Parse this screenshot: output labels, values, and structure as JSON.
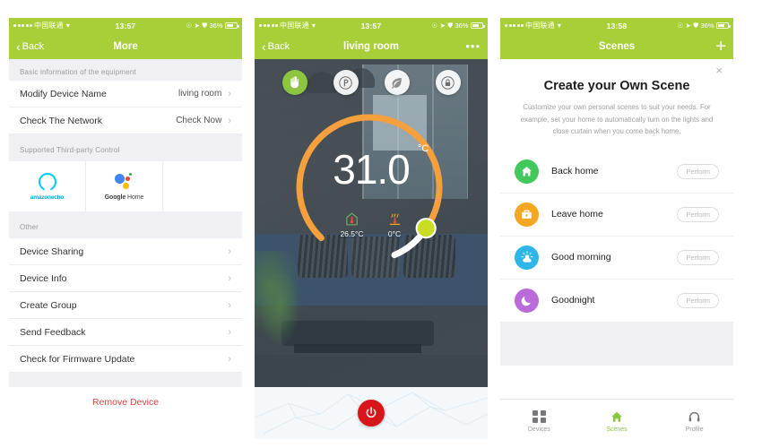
{
  "status_bar": {
    "carrier": "中国联通",
    "wifi_icon": "wifi-icon",
    "time_panel1": "13:57",
    "time_panel2": "13:57",
    "time_panel3": "13:58",
    "battery_pct": "36%",
    "alarm_icon": "alarm-icon",
    "location_icon": "location-arrow-icon",
    "rotation_icon": "rotation-lock-icon"
  },
  "panel1": {
    "nav": {
      "back_label": "Back",
      "title": "More"
    },
    "section_basic": "Basic information of the equipment",
    "rows_basic": [
      {
        "label": "Modify Device Name",
        "value": "living room"
      },
      {
        "label": "Check The Network",
        "value": "Check Now"
      }
    ],
    "section_third_party": "Supported Third-party Control",
    "third_party": [
      {
        "name": "amazon echo",
        "brand": "amazon",
        "product": "echo"
      },
      {
        "name": "Google Home",
        "brand": "Google",
        "product": "Home"
      }
    ],
    "section_other": "Other",
    "rows_other": [
      {
        "label": "Device Sharing"
      },
      {
        "label": "Device Info"
      },
      {
        "label": "Create Group"
      },
      {
        "label": "Send Feedback"
      },
      {
        "label": "Check for Firmware Update"
      }
    ],
    "remove_label": "Remove Device"
  },
  "panel2": {
    "nav": {
      "back_label": "Back",
      "title": "living room",
      "more_label": "•••"
    },
    "modes": [
      {
        "name": "manual-mode",
        "icon": "hand-icon",
        "active": true
      },
      {
        "name": "program-mode",
        "icon": "program-p-icon",
        "active": false
      },
      {
        "name": "eco-mode",
        "icon": "leaf-icon",
        "active": false
      },
      {
        "name": "lock-mode",
        "icon": "lock-icon",
        "active": false
      }
    ],
    "target_temp": "31.0",
    "temp_unit": "°C",
    "readouts": [
      {
        "icon": "house-thermometer-icon",
        "value": "26.5°C"
      },
      {
        "icon": "floor-heating-icon",
        "value": "0°C"
      }
    ],
    "power_icon": "power-icon",
    "dial_color": "#f5a03c",
    "handle_color": "#d4e02a"
  },
  "panel3": {
    "nav": {
      "title": "Scenes",
      "add_label": "+"
    },
    "close_label": "×",
    "title": "Create your Own Scene",
    "description": "Customize your own personal scenes to suit your needs. For example, set your home to automatically turn on the lights and close curtain when you come back home.",
    "scenes": [
      {
        "label": "Back home",
        "icon": "home-icon",
        "color": "#43c95b",
        "action": "Perform"
      },
      {
        "label": "Leave home",
        "icon": "briefcase-icon",
        "color": "#f5a623",
        "action": "Perform"
      },
      {
        "label": "Good morning",
        "icon": "sun-cloud-icon",
        "color": "#2fb6e8",
        "action": "Perform"
      },
      {
        "label": "Goodnight",
        "icon": "moon-icon",
        "color": "#bb6ada",
        "action": "Perform"
      }
    ],
    "tabs": [
      {
        "label": "Devices",
        "icon": "grid-icon",
        "active": false
      },
      {
        "label": "Scenes",
        "icon": "home-icon",
        "active": true
      },
      {
        "label": "Profile",
        "icon": "headset-icon",
        "active": false
      }
    ]
  },
  "theme": {
    "green": "#a8cf38",
    "accent_orange": "#f5a03c",
    "danger_red": "#d8151a"
  }
}
